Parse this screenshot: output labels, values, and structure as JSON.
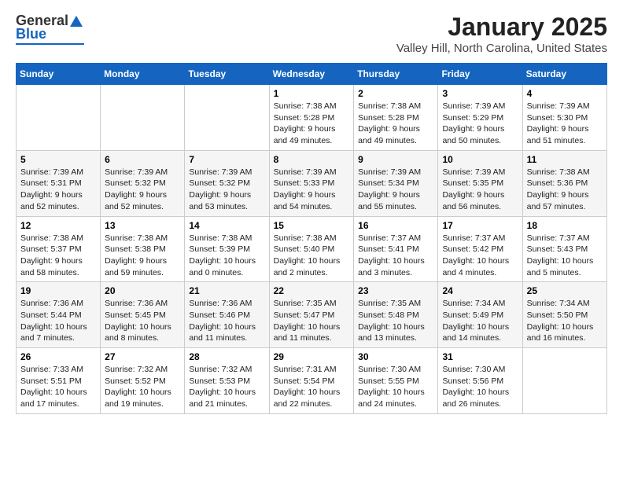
{
  "logo": {
    "general": "General",
    "blue": "Blue"
  },
  "title": "January 2025",
  "location": "Valley Hill, North Carolina, United States",
  "weekdays": [
    "Sunday",
    "Monday",
    "Tuesday",
    "Wednesday",
    "Thursday",
    "Friday",
    "Saturday"
  ],
  "weeks": [
    [
      null,
      null,
      null,
      {
        "day": "1",
        "sunrise": "Sunrise: 7:38 AM",
        "sunset": "Sunset: 5:28 PM",
        "daylight": "Daylight: 9 hours and 49 minutes."
      },
      {
        "day": "2",
        "sunrise": "Sunrise: 7:38 AM",
        "sunset": "Sunset: 5:28 PM",
        "daylight": "Daylight: 9 hours and 49 minutes."
      },
      {
        "day": "3",
        "sunrise": "Sunrise: 7:39 AM",
        "sunset": "Sunset: 5:29 PM",
        "daylight": "Daylight: 9 hours and 50 minutes."
      },
      {
        "day": "4",
        "sunrise": "Sunrise: 7:39 AM",
        "sunset": "Sunset: 5:30 PM",
        "daylight": "Daylight: 9 hours and 51 minutes."
      }
    ],
    [
      {
        "day": "5",
        "sunrise": "Sunrise: 7:39 AM",
        "sunset": "Sunset: 5:31 PM",
        "daylight": "Daylight: 9 hours and 52 minutes."
      },
      {
        "day": "6",
        "sunrise": "Sunrise: 7:39 AM",
        "sunset": "Sunset: 5:32 PM",
        "daylight": "Daylight: 9 hours and 52 minutes."
      },
      {
        "day": "7",
        "sunrise": "Sunrise: 7:39 AM",
        "sunset": "Sunset: 5:32 PM",
        "daylight": "Daylight: 9 hours and 53 minutes."
      },
      {
        "day": "8",
        "sunrise": "Sunrise: 7:39 AM",
        "sunset": "Sunset: 5:33 PM",
        "daylight": "Daylight: 9 hours and 54 minutes."
      },
      {
        "day": "9",
        "sunrise": "Sunrise: 7:39 AM",
        "sunset": "Sunset: 5:34 PM",
        "daylight": "Daylight: 9 hours and 55 minutes."
      },
      {
        "day": "10",
        "sunrise": "Sunrise: 7:39 AM",
        "sunset": "Sunset: 5:35 PM",
        "daylight": "Daylight: 9 hours and 56 minutes."
      },
      {
        "day": "11",
        "sunrise": "Sunrise: 7:38 AM",
        "sunset": "Sunset: 5:36 PM",
        "daylight": "Daylight: 9 hours and 57 minutes."
      }
    ],
    [
      {
        "day": "12",
        "sunrise": "Sunrise: 7:38 AM",
        "sunset": "Sunset: 5:37 PM",
        "daylight": "Daylight: 9 hours and 58 minutes."
      },
      {
        "day": "13",
        "sunrise": "Sunrise: 7:38 AM",
        "sunset": "Sunset: 5:38 PM",
        "daylight": "Daylight: 9 hours and 59 minutes."
      },
      {
        "day": "14",
        "sunrise": "Sunrise: 7:38 AM",
        "sunset": "Sunset: 5:39 PM",
        "daylight": "Daylight: 10 hours and 0 minutes."
      },
      {
        "day": "15",
        "sunrise": "Sunrise: 7:38 AM",
        "sunset": "Sunset: 5:40 PM",
        "daylight": "Daylight: 10 hours and 2 minutes."
      },
      {
        "day": "16",
        "sunrise": "Sunrise: 7:37 AM",
        "sunset": "Sunset: 5:41 PM",
        "daylight": "Daylight: 10 hours and 3 minutes."
      },
      {
        "day": "17",
        "sunrise": "Sunrise: 7:37 AM",
        "sunset": "Sunset: 5:42 PM",
        "daylight": "Daylight: 10 hours and 4 minutes."
      },
      {
        "day": "18",
        "sunrise": "Sunrise: 7:37 AM",
        "sunset": "Sunset: 5:43 PM",
        "daylight": "Daylight: 10 hours and 5 minutes."
      }
    ],
    [
      {
        "day": "19",
        "sunrise": "Sunrise: 7:36 AM",
        "sunset": "Sunset: 5:44 PM",
        "daylight": "Daylight: 10 hours and 7 minutes."
      },
      {
        "day": "20",
        "sunrise": "Sunrise: 7:36 AM",
        "sunset": "Sunset: 5:45 PM",
        "daylight": "Daylight: 10 hours and 8 minutes."
      },
      {
        "day": "21",
        "sunrise": "Sunrise: 7:36 AM",
        "sunset": "Sunset: 5:46 PM",
        "daylight": "Daylight: 10 hours and 11 minutes."
      },
      {
        "day": "22",
        "sunrise": "Sunrise: 7:35 AM",
        "sunset": "Sunset: 5:47 PM",
        "daylight": "Daylight: 10 hours and 11 minutes."
      },
      {
        "day": "23",
        "sunrise": "Sunrise: 7:35 AM",
        "sunset": "Sunset: 5:48 PM",
        "daylight": "Daylight: 10 hours and 13 minutes."
      },
      {
        "day": "24",
        "sunrise": "Sunrise: 7:34 AM",
        "sunset": "Sunset: 5:49 PM",
        "daylight": "Daylight: 10 hours and 14 minutes."
      },
      {
        "day": "25",
        "sunrise": "Sunrise: 7:34 AM",
        "sunset": "Sunset: 5:50 PM",
        "daylight": "Daylight: 10 hours and 16 minutes."
      }
    ],
    [
      {
        "day": "26",
        "sunrise": "Sunrise: 7:33 AM",
        "sunset": "Sunset: 5:51 PM",
        "daylight": "Daylight: 10 hours and 17 minutes."
      },
      {
        "day": "27",
        "sunrise": "Sunrise: 7:32 AM",
        "sunset": "Sunset: 5:52 PM",
        "daylight": "Daylight: 10 hours and 19 minutes."
      },
      {
        "day": "28",
        "sunrise": "Sunrise: 7:32 AM",
        "sunset": "Sunset: 5:53 PM",
        "daylight": "Daylight: 10 hours and 21 minutes."
      },
      {
        "day": "29",
        "sunrise": "Sunrise: 7:31 AM",
        "sunset": "Sunset: 5:54 PM",
        "daylight": "Daylight: 10 hours and 22 minutes."
      },
      {
        "day": "30",
        "sunrise": "Sunrise: 7:30 AM",
        "sunset": "Sunset: 5:55 PM",
        "daylight": "Daylight: 10 hours and 24 minutes."
      },
      {
        "day": "31",
        "sunrise": "Sunrise: 7:30 AM",
        "sunset": "Sunset: 5:56 PM",
        "daylight": "Daylight: 10 hours and 26 minutes."
      },
      null
    ]
  ]
}
